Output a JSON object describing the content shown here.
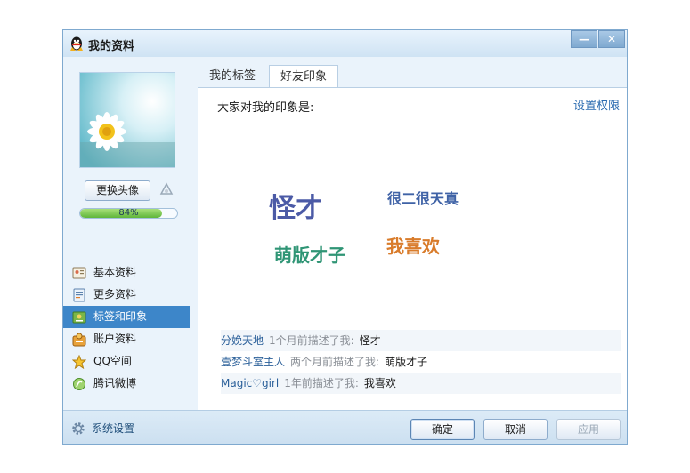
{
  "window": {
    "title": "我的资料",
    "min_glyph": "—",
    "close_glyph": "✕"
  },
  "left": {
    "change_avatar_label": "更换头像",
    "progress": {
      "value": 0.84,
      "label": "84%"
    },
    "nav": [
      {
        "label": "基本资料",
        "icon": "basic-info-icon"
      },
      {
        "label": "更多资料",
        "icon": "more-info-icon"
      },
      {
        "label": "标签和印象",
        "icon": "tags-icon",
        "active": true
      },
      {
        "label": "账户资料",
        "icon": "account-icon"
      },
      {
        "label": "QQ空间",
        "icon": "star-icon"
      },
      {
        "label": "腾讯微博",
        "icon": "weibo-icon"
      }
    ],
    "settings_label": "系统设置"
  },
  "tabs": [
    {
      "label": "我的标签"
    },
    {
      "label": "好友印象",
      "active": true
    }
  ],
  "content": {
    "heading": "大家对我的印象是:",
    "permission_link": "设置权限",
    "tags": [
      {
        "text": "怪才",
        "color": "#4b5aa6"
      },
      {
        "text": "很二很天真",
        "color": "#3f62a6"
      },
      {
        "text": "萌版才子",
        "color": "#2f9575"
      },
      {
        "text": "我喜欢",
        "color": "#d97c2b"
      }
    ],
    "comments": [
      {
        "who": "分娩天地",
        "when": "1个月前描述了我:",
        "what": "怪才"
      },
      {
        "who": "壹梦斗室主人",
        "when": "两个月前描述了我:",
        "what": "萌版才子"
      },
      {
        "who": "Magic♡girl",
        "when": "1年前描述了我:",
        "what": "我喜欢"
      }
    ]
  },
  "buttons": {
    "ok": "确定",
    "cancel": "取消",
    "apply": "应用"
  },
  "colors": {
    "accent": "#3d86c9",
    "link": "#2a6bb0",
    "window_bg": "#eaf3fb"
  }
}
